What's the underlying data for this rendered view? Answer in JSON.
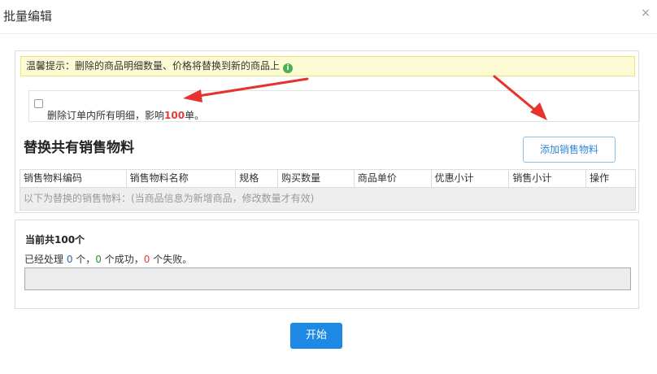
{
  "dialog": {
    "title": "批量编辑",
    "close_label": "×"
  },
  "tip": {
    "text": "温馨提示：删除的商品明细数量、价格将替换到新的商品上",
    "icon": "info-icon"
  },
  "delete_option": {
    "checked": false,
    "text_prefix": "删除订单内所有明细，影响",
    "count": "100",
    "text_suffix": "单。"
  },
  "section": {
    "title": "替换共有销售物料",
    "add_button": "添加销售物料"
  },
  "table": {
    "columns": [
      "销售物料编码",
      "销售物料名称",
      "规格",
      "购买数量",
      "商品单价",
      "优惠小计",
      "销售小计",
      "操作"
    ],
    "empty_text": "以下为替换的销售物料：(当商品信息为新增商品，修改数量才有效)"
  },
  "progress": {
    "total_label": "当前共100个",
    "processed_prefix": "已经处理 ",
    "processed": "0",
    "processed_suffix": " 个，",
    "success": "0",
    "success_suffix": " 个成功，",
    "fail": "0",
    "fail_suffix": " 个失败。",
    "fraction": 0
  },
  "start_button": "开始",
  "colors": {
    "accent": "#1e88e5",
    "highlight_red": "#e23b3b",
    "tip_background": "#fcfbd3",
    "annotation_arrow": "#e8322f"
  }
}
